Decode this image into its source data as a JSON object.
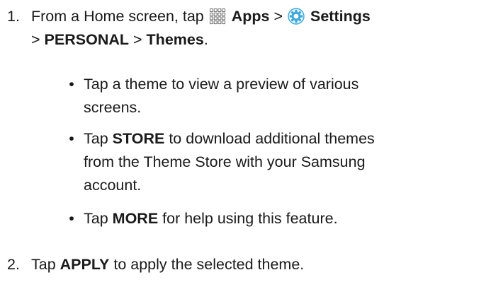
{
  "steps": [
    {
      "number": "1.",
      "line1_prefix": "From a Home screen, tap",
      "apps_icon": "apps-grid-icon",
      "apps_label": "Apps",
      "sep1": ">",
      "settings_icon": "settings-gear-icon",
      "settings_label": "Settings",
      "sep2": ">",
      "personal_label": "PERSONAL",
      "sep3": ">",
      "themes_label": "Themes",
      "end": "."
    },
    {
      "number": "2.",
      "prefix": "Tap",
      "apply_label": "APPLY",
      "suffix": "to apply the selected theme."
    }
  ],
  "bullets": [
    {
      "text_line1": "Tap a theme to view a preview of various",
      "text_line2": "screens."
    },
    {
      "prefix": "Tap",
      "store_label": "STORE",
      "text_line1_rest": "to download additional themes",
      "text_line2": "from the Theme Store with your Samsung",
      "text_line3": "account."
    },
    {
      "prefix": "Tap",
      "more_label": "MORE",
      "rest": "for help using this feature."
    }
  ],
  "bullet_glyph": "•",
  "colors": {
    "text": "#1a1a1a",
    "icon_grid": "#6b6b6b",
    "icon_gear": "#3fa9d8"
  }
}
